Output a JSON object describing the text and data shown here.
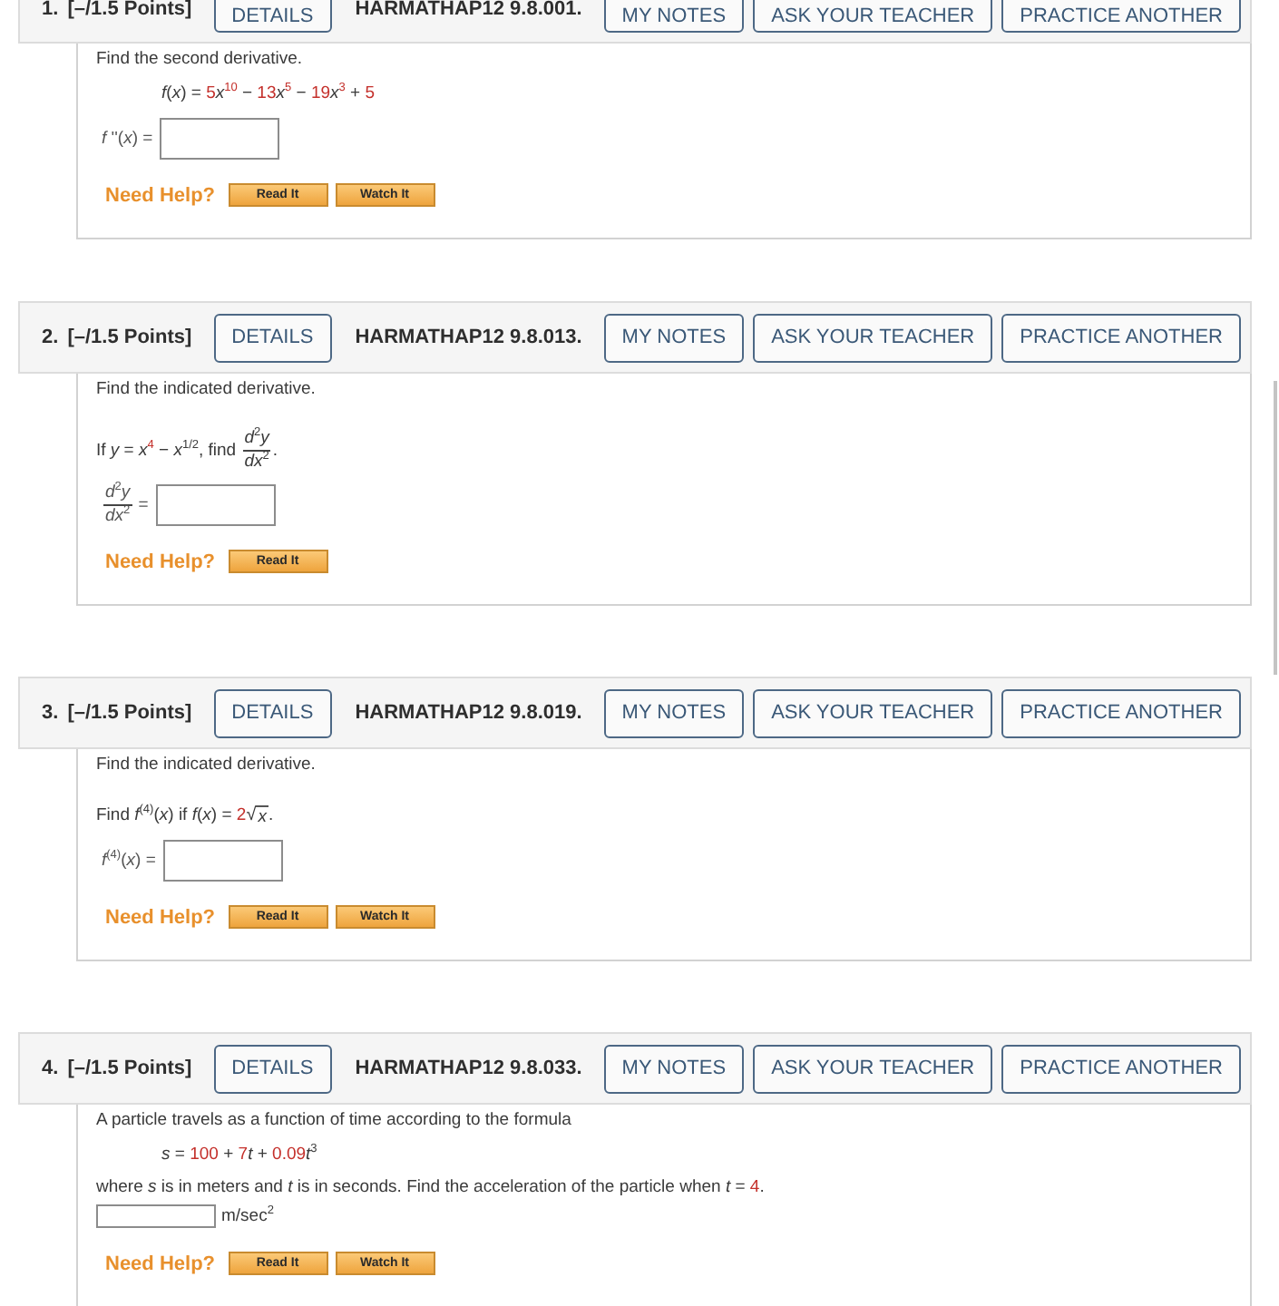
{
  "questions": [
    {
      "number": "1.",
      "points": "[–/1.5 Points]",
      "details_button": "DETAILS",
      "code": "HARMATHAP12 9.8.001.",
      "buttons": [
        "MY NOTES",
        "ASK YOUR TEACHER",
        "PRACTICE ANOTHER"
      ],
      "body": [
        {
          "kind": "text",
          "parts": [
            {
              "kind": "plain",
              "text": "Find the second derivative."
            }
          ]
        },
        {
          "kind": "formula",
          "parts": [
            {
              "kind": "plain",
              "text": "*f*(*x*) = "
            },
            {
              "kind": "value",
              "text": "5"
            },
            {
              "kind": "plain",
              "text": "*x*"
            },
            {
              "kind": "value",
              "text": "$^{10}$"
            },
            {
              "kind": "plain",
              "text": " − "
            },
            {
              "kind": "value",
              "text": "13"
            },
            {
              "kind": "plain",
              "text": "*x*"
            },
            {
              "kind": "value",
              "text": "$^{5}$"
            },
            {
              "kind": "plain",
              "text": " − "
            },
            {
              "kind": "value",
              "text": "19"
            },
            {
              "kind": "plain",
              "text": "*x*"
            },
            {
              "kind": "value",
              "text": "$^{3}$"
            },
            {
              "kind": "plain",
              "text": " + "
            },
            {
              "kind": "value",
              "text": "5"
            }
          ]
        },
        {
          "kind": "answer",
          "label": [
            {
              "kind": "plain",
              "text": "*f* ''(*x*) ="
            }
          ]
        }
      ],
      "help": {
        "label": "Need Help?",
        "buttons": [
          "Read It",
          "Watch It"
        ]
      }
    },
    {
      "number": "2.",
      "points": "[–/1.5 Points]",
      "details_button": "DETAILS",
      "code": "HARMATHAP12 9.8.013.",
      "buttons": [
        "MY NOTES",
        "ASK YOUR TEACHER",
        "PRACTICE ANOTHER"
      ],
      "body": [
        {
          "kind": "text",
          "parts": [
            {
              "kind": "plain",
              "text": "Find the indicated derivative."
            }
          ]
        },
        {
          "kind": "text",
          "parts": [
            {
              "kind": "plain",
              "text": "If *y* = *x*"
            },
            {
              "kind": "value",
              "text": "$^{4}$"
            },
            {
              "kind": "plain",
              "text": " − *x*$^{1/2}$, find "
            },
            {
              "kind": "fraction",
              "numerator": "*d*$^{2}$*y*",
              "denominator": "*dx*$^{2}$"
            },
            {
              "kind": "plain",
              "text": "."
            }
          ]
        },
        {
          "kind": "answer",
          "label": [
            {
              "kind": "fraction",
              "numerator": "*d*$^{2}$*y*",
              "denominator": "*dx*$^{2}$"
            },
            {
              "kind": "plain",
              "text": " ="
            }
          ]
        }
      ],
      "help": {
        "label": "Need Help?",
        "buttons": [
          "Read It"
        ]
      }
    },
    {
      "number": "3.",
      "points": "[–/1.5 Points]",
      "details_button": "DETAILS",
      "code": "HARMATHAP12 9.8.019.",
      "buttons": [
        "MY NOTES",
        "ASK YOUR TEACHER",
        "PRACTICE ANOTHER"
      ],
      "body": [
        {
          "kind": "text",
          "parts": [
            {
              "kind": "plain",
              "text": "Find the indicated derivative."
            }
          ]
        },
        {
          "kind": "text",
          "parts": [
            {
              "kind": "plain",
              "text": "Find *f*$^{(4)}$(*x*) if *f*(*x*) = "
            },
            {
              "kind": "value",
              "text": "2"
            },
            {
              "kind": "sqrt",
              "sign": "√",
              "text": "*x*"
            },
            {
              "kind": "plain",
              "text": "."
            }
          ]
        },
        {
          "kind": "answer",
          "label": [
            {
              "kind": "plain",
              "text": "*f*$^{(4)}$(*x*)  ="
            }
          ]
        }
      ],
      "help": {
        "label": "Need Help?",
        "buttons": [
          "Read It",
          "Watch It"
        ]
      }
    },
    {
      "number": "4.",
      "points": "[–/1.5 Points]",
      "details_button": "DETAILS",
      "code": "HARMATHAP12 9.8.033.",
      "buttons": [
        "MY NOTES",
        "ASK YOUR TEACHER",
        "PRACTICE ANOTHER"
      ],
      "body": [
        {
          "kind": "text",
          "parts": [
            {
              "kind": "plain",
              "text": "A particle travels as a function of time according to the formula"
            }
          ]
        },
        {
          "kind": "formula",
          "parts": [
            {
              "kind": "plain",
              "text": "*s* = "
            },
            {
              "kind": "value",
              "text": "100"
            },
            {
              "kind": "plain",
              "text": " + "
            },
            {
              "kind": "value",
              "text": "7"
            },
            {
              "kind": "plain",
              "text": "*t* + "
            },
            {
              "kind": "value",
              "text": "0.09"
            },
            {
              "kind": "plain",
              "text": "*t*$^{3}$"
            }
          ]
        },
        {
          "kind": "text",
          "parts": [
            {
              "kind": "plain",
              "text": "where *s* is in meters and *t* is in seconds. Find the acceleration of the particle when  *t* = "
            },
            {
              "kind": "value",
              "text": "4"
            },
            {
              "kind": "plain",
              "text": "."
            }
          ]
        },
        {
          "kind": "inline_answer",
          "unit": [
            {
              "kind": "plain",
              "text": "m/sec$^{2}$"
            }
          ]
        }
      ],
      "help": {
        "label": "Need Help?",
        "buttons": [
          "Read It",
          "Watch It"
        ]
      }
    }
  ]
}
